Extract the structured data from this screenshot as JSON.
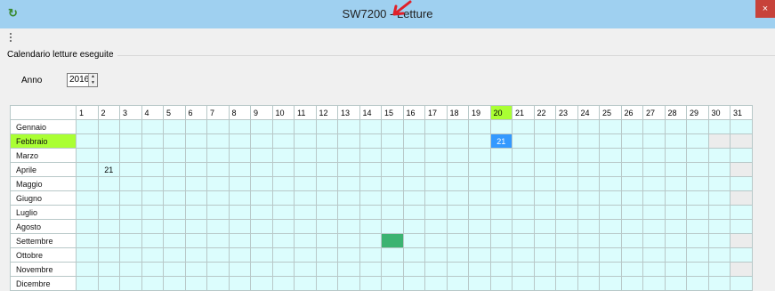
{
  "window": {
    "title": "SW7200 - Letture",
    "app_icon": "refresh-icon",
    "close_label": "×"
  },
  "group": {
    "title": "Calendario letture eseguite"
  },
  "year": {
    "label": "Anno",
    "value": "2016"
  },
  "calendar": {
    "days": [
      "1",
      "2",
      "3",
      "4",
      "5",
      "6",
      "7",
      "8",
      "9",
      "10",
      "11",
      "12",
      "13",
      "14",
      "15",
      "16",
      "17",
      "18",
      "19",
      "20",
      "21",
      "22",
      "23",
      "24",
      "25",
      "26",
      "27",
      "28",
      "29",
      "30",
      "31"
    ],
    "highlighted_day": "20",
    "highlighted_month": "Febbraio",
    "months": [
      {
        "name": "Gennaio",
        "days_in_month": 31,
        "cells": {}
      },
      {
        "name": "Febbraio",
        "days_in_month": 29,
        "cells": {
          "20": {
            "text": "21",
            "state": "selected"
          }
        }
      },
      {
        "name": "Marzo",
        "days_in_month": 31,
        "cells": {}
      },
      {
        "name": "Aprile",
        "days_in_month": 30,
        "cells": {
          "2": {
            "text": "21",
            "state": "value"
          }
        }
      },
      {
        "name": "Maggio",
        "days_in_month": 31,
        "cells": {}
      },
      {
        "name": "Giugno",
        "days_in_month": 30,
        "cells": {}
      },
      {
        "name": "Luglio",
        "days_in_month": 31,
        "cells": {}
      },
      {
        "name": "Agosto",
        "days_in_month": 31,
        "cells": {}
      },
      {
        "name": "Settembre",
        "days_in_month": 30,
        "cells": {
          "15": {
            "text": "",
            "state": "marked"
          }
        }
      },
      {
        "name": "Ottobre",
        "days_in_month": 31,
        "cells": {}
      },
      {
        "name": "Novembre",
        "days_in_month": 30,
        "cells": {}
      },
      {
        "name": "Dicembre",
        "days_in_month": 31,
        "cells": {}
      }
    ]
  },
  "colors": {
    "titlebar": "#9fd0f0",
    "cell": "#dcfdfd",
    "highlight": "#aaff33",
    "selected": "#3399ff",
    "marked": "#3cb371",
    "close": "#c7423a",
    "arrow": "#e0202a"
  }
}
